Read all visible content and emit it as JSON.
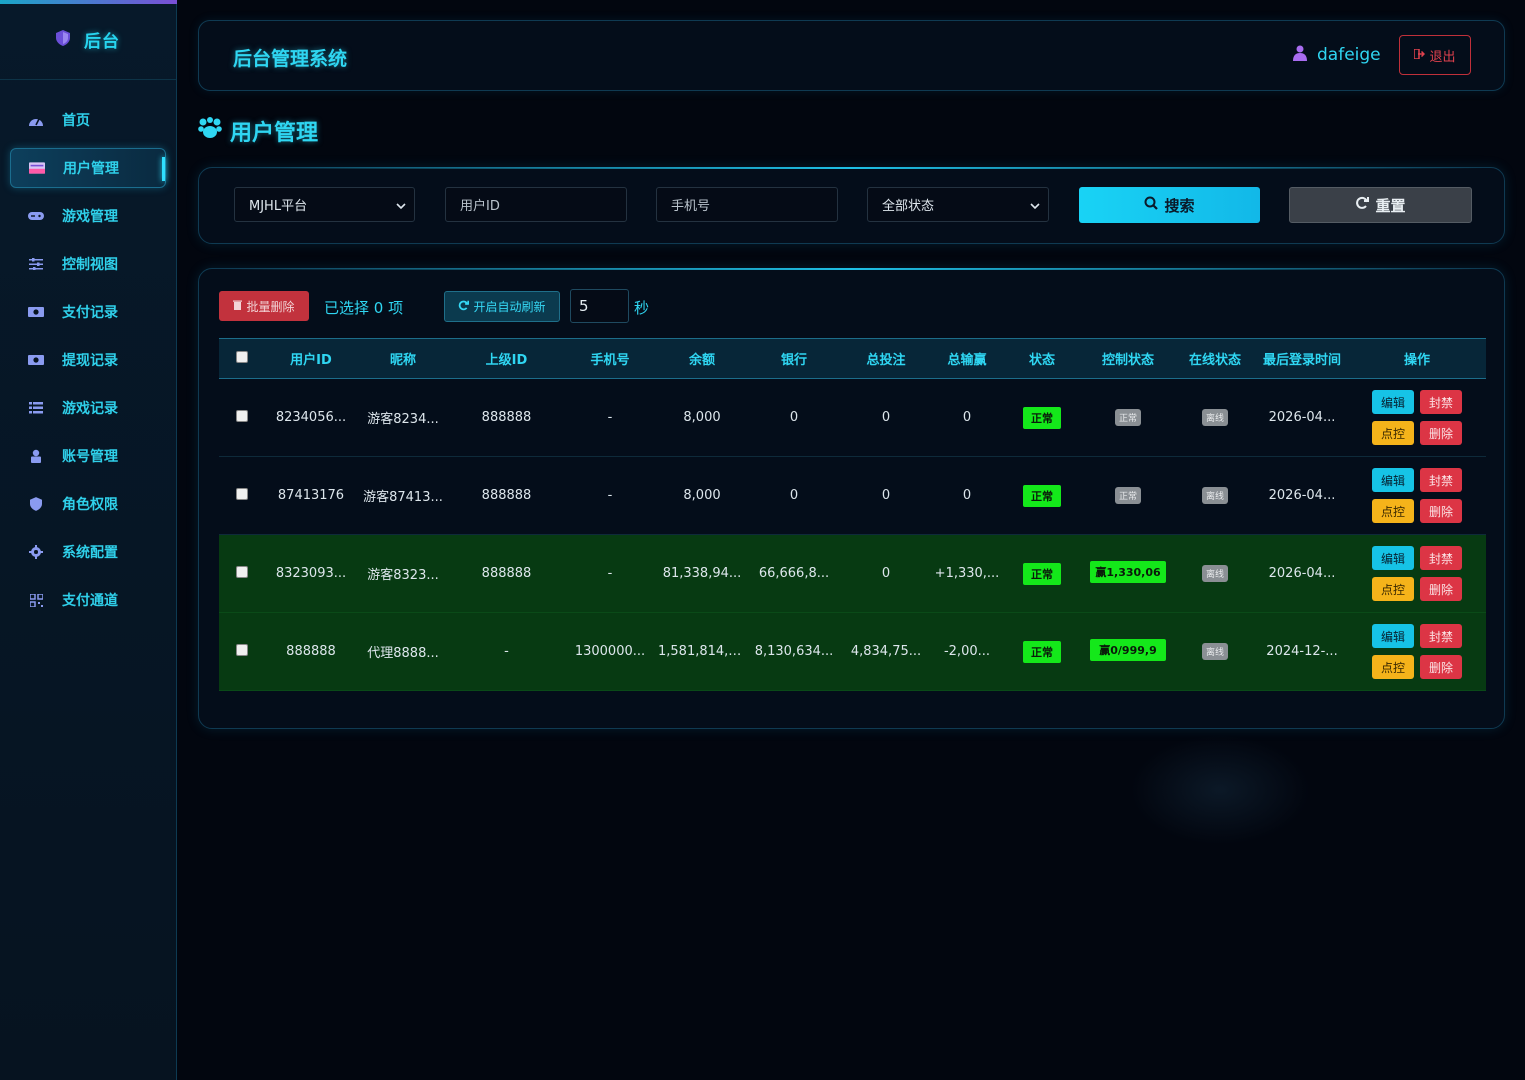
{
  "sidebar": {
    "brand": "后台",
    "items": [
      {
        "label": "首页",
        "icon": "dashboard-icon"
      },
      {
        "label": "用户管理",
        "icon": "users-icon",
        "active": true
      },
      {
        "label": "游戏管理",
        "icon": "gamepad-icon"
      },
      {
        "label": "控制视图",
        "icon": "sliders-icon"
      },
      {
        "label": "支付记录",
        "icon": "money-icon"
      },
      {
        "label": "提现记录",
        "icon": "money-icon"
      },
      {
        "label": "游戏记录",
        "icon": "list-icon"
      },
      {
        "label": "账号管理",
        "icon": "user-lock-icon"
      },
      {
        "label": "角色权限",
        "icon": "shield-icon"
      },
      {
        "label": "系统配置",
        "icon": "gear-icon"
      },
      {
        "label": "支付通道",
        "icon": "qrcode-icon"
      }
    ]
  },
  "header": {
    "title": "后台管理系统",
    "username": "dafeige",
    "logout_label": "退出"
  },
  "page": {
    "title": "用户管理"
  },
  "filter": {
    "platform_value": "MJHL平台",
    "userid_placeholder": "用户ID",
    "phone_placeholder": "手机号",
    "status_value": "全部状态",
    "search_label": "搜索",
    "reset_label": "重置"
  },
  "toolbar": {
    "bulk_delete_label": "批量删除",
    "selected_text": "已选择 0 项",
    "auto_refresh_label": "开启自动刷新",
    "interval_value": "5",
    "interval_unit": "秒"
  },
  "table": {
    "headers": [
      "用户ID",
      "昵称",
      "上级ID",
      "手机号",
      "余额",
      "银行",
      "总投注",
      "总输赢",
      "状态",
      "控制状态",
      "在线状态",
      "最后登录时间",
      "操作"
    ],
    "rows": [
      {
        "userid": "8234056...",
        "nickname": "游客8234...",
        "parent": "888888",
        "phone": "-",
        "balance": "8,000",
        "bank": "0",
        "bet": "0",
        "winloss": "0",
        "winloss_type": "zero",
        "status": "正常",
        "control": "正常",
        "control_type": "gray",
        "online": "离线",
        "last_login": "2026-04...",
        "highlight": false
      },
      {
        "userid": "87413176",
        "nickname": "游客87413...",
        "parent": "888888",
        "phone": "-",
        "balance": "8,000",
        "bank": "0",
        "bet": "0",
        "winloss": "0",
        "winloss_type": "zero",
        "status": "正常",
        "control": "正常",
        "control_type": "gray",
        "online": "离线",
        "last_login": "2026-04...",
        "highlight": false
      },
      {
        "userid": "8323093...",
        "nickname": "游客8323...",
        "parent": "888888",
        "phone": "-",
        "balance": "81,338,94...",
        "bank": "66,666,8...",
        "bet": "0",
        "winloss": "+1,330,...",
        "winloss_type": "pos",
        "status": "正常",
        "control": "赢1,330,06",
        "control_type": "green",
        "online": "离线",
        "last_login": "2026-04...",
        "highlight": true
      },
      {
        "userid": "888888",
        "nickname": "代理8888...",
        "parent": "-",
        "phone": "1300000...",
        "balance": "1,581,814,5...",
        "bank": "8,130,634...",
        "bet": "4,834,75...",
        "winloss": "-2,00...",
        "winloss_type": "neg",
        "status": "正常",
        "control": "赢0/999,9",
        "control_type": "green",
        "online": "离线",
        "last_login": "2024-12-...",
        "highlight": true
      }
    ],
    "ops": {
      "edit": "编辑",
      "ban": "封禁",
      "control": "点控",
      "delete": "删除"
    }
  },
  "colors": {
    "accent": "#2fd6f2",
    "danger": "#dc3545",
    "warning": "#f5b31a",
    "success": "#14e81a",
    "background": "#02060f"
  }
}
